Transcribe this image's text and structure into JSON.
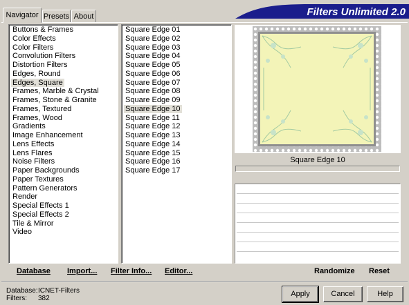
{
  "tabs": [
    {
      "label": "Navigator",
      "active": true
    },
    {
      "label": "Presets",
      "active": false
    },
    {
      "label": "About",
      "active": false
    }
  ],
  "banner": {
    "title": "Filters Unlimited 2.0",
    "color": "#1a1d8c"
  },
  "categories": [
    "Buttons & Frames",
    "Color Effects",
    "Color Filters",
    "Convolution Filters",
    "Distortion Filters",
    "Edges, Round",
    "Edges, Square",
    "Frames, Marble & Crystal",
    "Frames, Stone & Granite",
    "Frames, Textured",
    "Frames, Wood",
    "Gradients",
    "Image Enhancement",
    "Lens Effects",
    "Lens Flares",
    "Noise Filters",
    "Paper Backgrounds",
    "Paper Textures",
    "Pattern Generators",
    "Render",
    "Special Effects 1",
    "Special Effects 2",
    "Tile & Mirror",
    "Video"
  ],
  "selected_category": "Edges, Square",
  "filters": [
    "Square Edge 01",
    "Square Edge 02",
    "Square Edge 03",
    "Square Edge 04",
    "Square Edge 05",
    "Square Edge 06",
    "Square Edge 07",
    "Square Edge 08",
    "Square Edge 09",
    "Square Edge 10",
    "Square Edge 11",
    "Square Edge 12",
    "Square Edge 13",
    "Square Edge 14",
    "Square Edge 15",
    "Square Edge 16",
    "Square Edge 17"
  ],
  "selected_filter": "Square Edge 10",
  "preview": {
    "caption": "Square Edge 10",
    "fill_color": "#f3f4b8",
    "border_color": "#9a9a9a"
  },
  "toolbar": {
    "database": "Database",
    "import": "Import...",
    "filter_info": "Filter Info...",
    "editor": "Editor...",
    "randomize": "Randomize",
    "reset": "Reset"
  },
  "status": {
    "database_label": "Database:",
    "database_value": "ICNET-Filters",
    "filters_label": "Filters:",
    "filters_value": "382"
  },
  "buttons": {
    "apply": "Apply",
    "cancel": "Cancel",
    "help": "Help"
  }
}
